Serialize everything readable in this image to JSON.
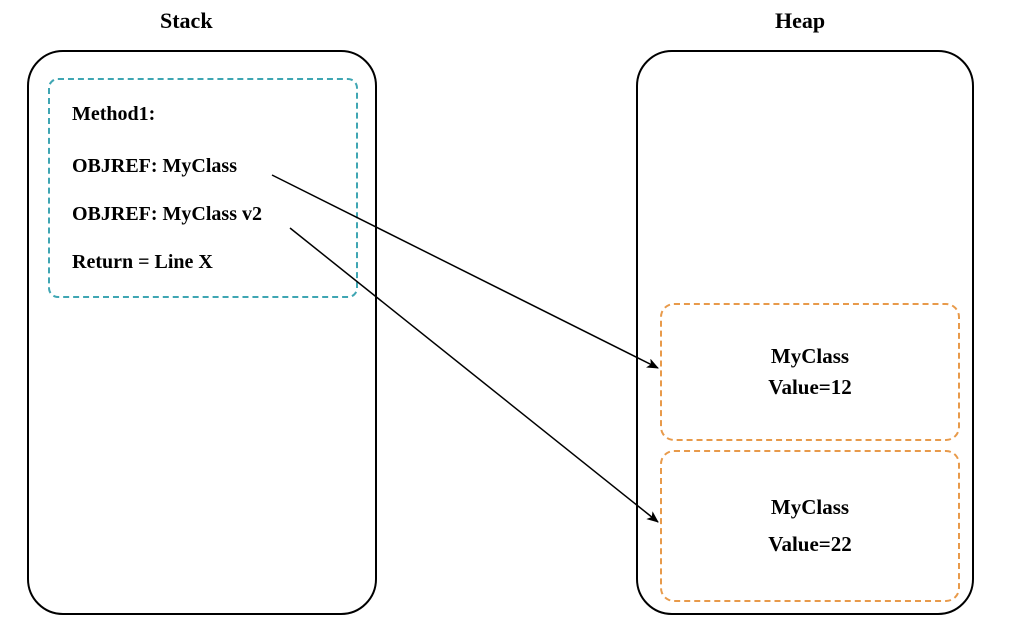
{
  "titles": {
    "stack": "Stack",
    "heap": "Heap"
  },
  "stackFrame": {
    "method": "Method1:",
    "ref1": "OBJREF: MyClass",
    "ref2": "OBJREF: MyClass v2",
    "returnLine": "Return = Line X"
  },
  "heapObjects": {
    "obj1": {
      "className": "MyClass",
      "valueLine": "Value=12"
    },
    "obj2": {
      "className": "MyClass",
      "valueLine": "Value=22"
    }
  }
}
